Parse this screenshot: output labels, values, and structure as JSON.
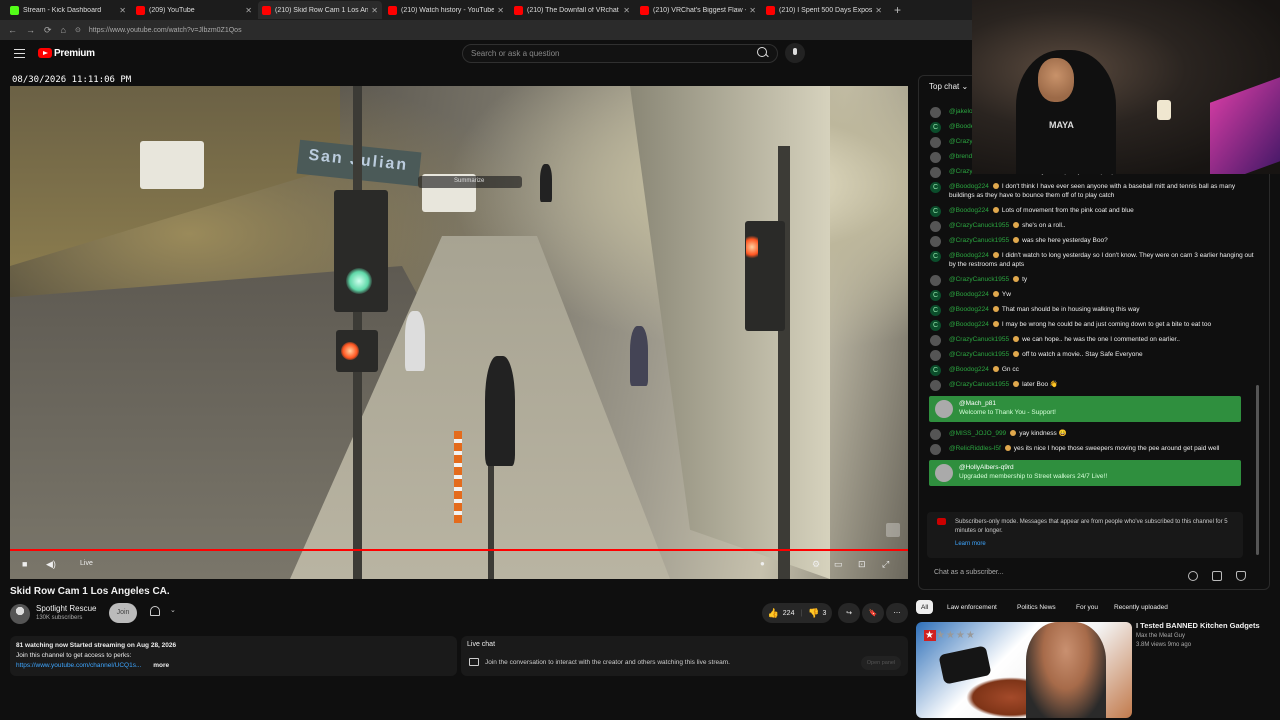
{
  "browser": {
    "tabs": [
      {
        "label": "Stream - Kick Dashboard",
        "color": "#53fc18",
        "active": false
      },
      {
        "label": "(209) YouTube",
        "color": "#ff0000",
        "active": false
      },
      {
        "label": "(210) Skid Row Cam 1 Los Angeles",
        "color": "#ff0000",
        "active": true
      },
      {
        "label": "(210) Watch history - YouTube",
        "color": "#ff0000",
        "active": false
      },
      {
        "label": "(210) The Downfall of VRchat - Yo",
        "color": "#ff0000",
        "active": false
      },
      {
        "label": "(210) VRChat's Biggest Flaw - You",
        "color": "#ff0000",
        "active": false
      },
      {
        "label": "(210) I Spent 500 Days Exposing V",
        "color": "#ff0000",
        "active": false
      }
    ],
    "url": "https://www.youtube.com/watch?v=Jlbzm0Z1Qos"
  },
  "header": {
    "brand": "Premium",
    "search_placeholder": "Search or ask a question"
  },
  "player": {
    "timestamp": "08/30/2026 11:11:06 PM",
    "live_label": "Live",
    "overlay_summarize": "Summarize",
    "street_sign": "San Julian"
  },
  "video": {
    "title": "Skid Row Cam 1 Los Angeles CA.",
    "channel": "Spotlight Rescue",
    "subscribers": "130K subscribers",
    "join_label": "Join",
    "likes": "224",
    "dislikes": "3",
    "description_line1": "81 watching now  Started streaming on Aug 28, 2026",
    "description_line2": "Join this channel to get access to perks:",
    "description_link": "https://www.youtube.com/channel/UCQ1s...",
    "more_label": "more"
  },
  "livechat_panel": {
    "title": "Live chat",
    "text": "Join the conversation to interact with the creator and others watching this live stream.",
    "open_panel": "Open panel"
  },
  "chat": {
    "header": "Top chat",
    "messages": [
      {
        "author": "@jakelo",
        "text": "",
        "avatar": "img"
      },
      {
        "author": "@Boode",
        "text": "the mis",
        "avatar": "c"
      },
      {
        "author": "@Crazy",
        "text": "",
        "avatar": "img"
      },
      {
        "author": "@brend",
        "text": "",
        "avatar": "img"
      },
      {
        "author": "@CrazyCanuck1955",
        "text": "the lady in the pink jacket up top ever rest?",
        "avatar": "img"
      },
      {
        "author": "@Boodog224",
        "text": "I don't think I have ever seen anyone with a baseball mitt and tennis ball as many buildings as they have to bounce them off of to play catch",
        "avatar": "c"
      },
      {
        "author": "@Boodog224",
        "text": "Lots of movement from the pink coat and blue",
        "avatar": "c"
      },
      {
        "author": "@CrazyCanuck1955",
        "text": "she's on a roll..",
        "avatar": "img"
      },
      {
        "author": "@CrazyCanuck1955",
        "text": "was she here yesterday Boo?",
        "avatar": "img"
      },
      {
        "author": "@Boodog224",
        "text": "I didn't watch to long yesterday so I don't know. They were on cam 3 earlier hanging out by the restrooms and apts",
        "avatar": "c"
      },
      {
        "author": "@CrazyCanuck1955",
        "text": "ty",
        "avatar": "img"
      },
      {
        "author": "@Boodog224",
        "text": "Yw",
        "avatar": "c"
      },
      {
        "author": "@Boodog224",
        "text": "That man should be in housing walking this way",
        "avatar": "c"
      },
      {
        "author": "@Boodog224",
        "text": "I may be wrong he could be and just coming down to get a bite to eat too",
        "avatar": "c"
      },
      {
        "author": "@CrazyCanuck1955",
        "text": "we can hope.. he was the one I commented on earlier..",
        "avatar": "img"
      },
      {
        "author": "@CrazyCanuck1955",
        "text": "off to watch a movie.. Stay Safe Everyone",
        "avatar": "img"
      },
      {
        "author": "@Boodog224",
        "text": "Gn cc",
        "avatar": "c"
      },
      {
        "author": "@CrazyCanuck1955",
        "text": "later Boo 👋",
        "avatar": "img"
      }
    ],
    "member1": {
      "author": "@Mach_p81",
      "text": "Welcome to Thank You - Support!"
    },
    "messages2": [
      {
        "author": "@MISS_JOJO_999",
        "text": "yay kindness 😄",
        "avatar": "img"
      },
      {
        "author": "@RelicRiddles-l5f",
        "text": "yes its nice I hope those sweepers moving the pee around get paid well",
        "avatar": "img"
      }
    ],
    "member2": {
      "author": "@HollyAlbers-q9rd",
      "text": "Upgraded membership to Street walkers 24/7 Live!!"
    },
    "submode_text": "Subscribers-only mode. Messages that appear are from people who've subscribed to this channel for 5 minutes or longer.",
    "learn_more": "Learn more",
    "input_placeholder": "Chat as a subscriber..."
  },
  "recommendations": {
    "chips": [
      "All",
      "Law enforcement",
      "Politics News",
      "For you",
      "Recently uploaded"
    ],
    "first": {
      "title": "I Tested BANNED Kitchen Gadgets",
      "channel": "Max the Meat Guy",
      "meta": "3.8M views  9mo ago"
    }
  },
  "webcam": {
    "shirt_text": "MAYA"
  }
}
